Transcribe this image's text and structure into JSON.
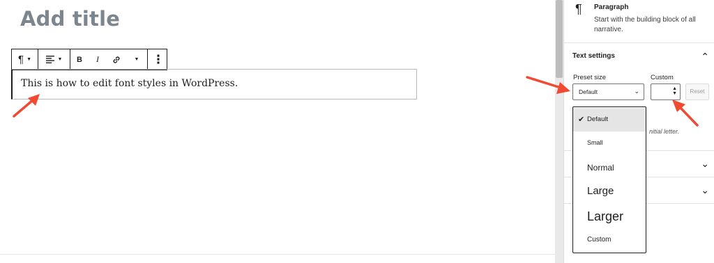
{
  "editor": {
    "title_placeholder": "Add title",
    "paragraph_text": "This is how to edit font styles in WordPress."
  },
  "toolbar": {
    "icons": [
      "pilcrow-icon",
      "align-left-icon",
      "bold-icon",
      "italic-icon",
      "link-icon",
      "chevron-down-icon",
      "more-vertical-icon"
    ],
    "paragraph_icon": "¶",
    "bold_label": "B",
    "italic_label": "I",
    "more_icon": "⋮"
  },
  "sidebar": {
    "block_card": {
      "icon": "¶",
      "title": "Paragraph",
      "description": "Start with the building block of all narrative."
    },
    "text_settings": {
      "title": "Text settings",
      "preset_label": "Preset size",
      "custom_label": "Custom",
      "preset_value": "Default",
      "reset_label": "Reset",
      "hint_fragment": "nitial letter."
    },
    "chevron_up": "⌃",
    "chevron_down": "⌄"
  },
  "dropdown": {
    "options": [
      {
        "label": "Default",
        "selected": true
      },
      {
        "label": "Small",
        "selected": false
      },
      {
        "label": "Normal",
        "selected": false
      },
      {
        "label": "Large",
        "selected": false
      },
      {
        "label": "Larger",
        "selected": false
      },
      {
        "label": "Custom",
        "selected": false
      }
    ],
    "check_mark": "✔"
  },
  "colors": {
    "annotation_arrow": "#f04a32",
    "title_placeholder": "#7d868f",
    "selected_option_bg": "#e5e5e5"
  }
}
